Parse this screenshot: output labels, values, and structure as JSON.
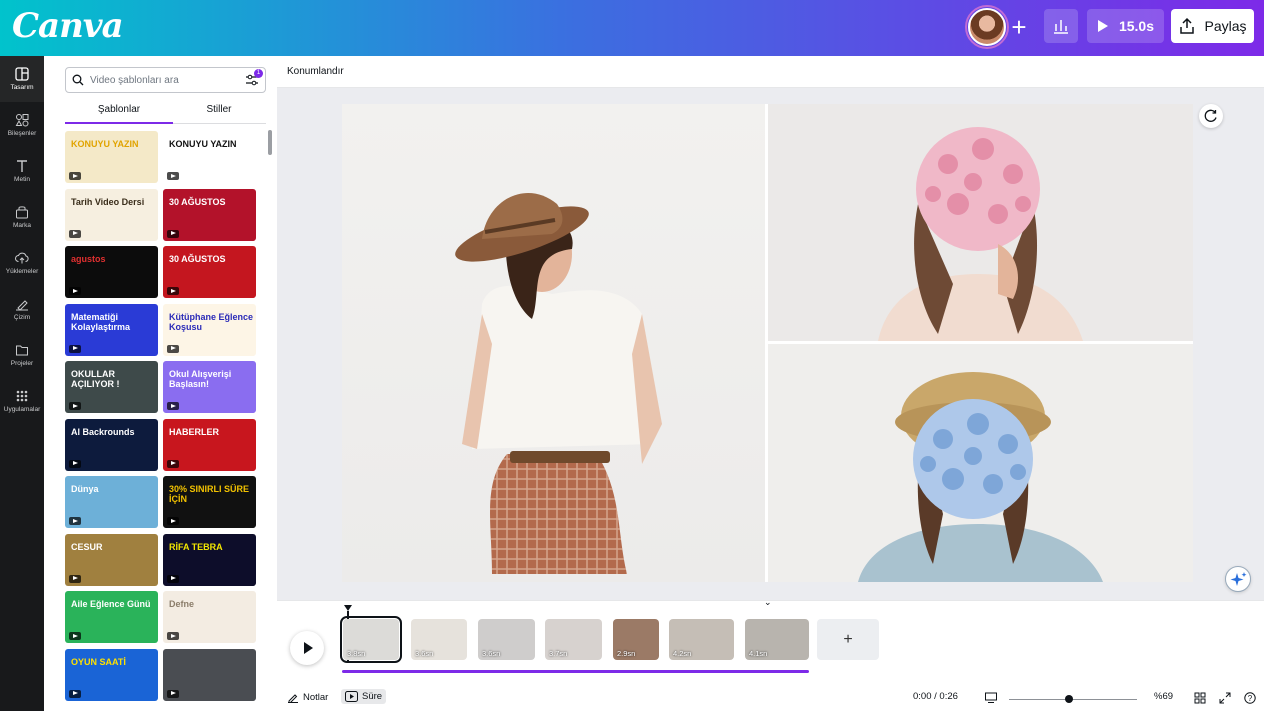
{
  "header": {
    "logo": "Canva",
    "present_label": "15.0s",
    "share_label": "Paylaş"
  },
  "rail": {
    "items": [
      {
        "label": "Tasarım",
        "icon": "layout-icon",
        "active": true
      },
      {
        "label": "Bileşenler",
        "icon": "shapes-icon"
      },
      {
        "label": "Metin",
        "icon": "text-icon"
      },
      {
        "label": "Marka",
        "icon": "brand-icon"
      },
      {
        "label": "Yüklemeler",
        "icon": "upload-icon"
      },
      {
        "label": "Çizim",
        "icon": "draw-icon"
      },
      {
        "label": "Projeler",
        "icon": "folder-icon"
      },
      {
        "label": "Uygulamalar",
        "icon": "apps-icon"
      }
    ]
  },
  "panel": {
    "search_placeholder": "Video şablonları ara",
    "filter_badge": "1",
    "tabs": [
      "Şablonlar",
      "Stiller"
    ],
    "templates": [
      {
        "text": "KONUYU YAZIN",
        "bg": "#f4e9c8",
        "fg": "#e1a400"
      },
      {
        "text": "KONUYU YAZIN",
        "bg": "#ffffff",
        "fg": "#111111"
      },
      {
        "text": "Tarih Video Dersi",
        "bg": "#f6efe0",
        "fg": "#3a2d1a"
      },
      {
        "text": "30 AĞUSTOS",
        "bg": "#b3122a",
        "fg": "#ffffff"
      },
      {
        "text": "agustos",
        "bg": "#0c0c0c",
        "fg": "#e03030"
      },
      {
        "text": "30 AĞUSTOS",
        "bg": "#c4161f",
        "fg": "#ffffff"
      },
      {
        "text": "Matematiği Kolaylaştırma",
        "bg": "#2a3bd6",
        "fg": "#ffffff"
      },
      {
        "text": "Kütüphane Eğlence Koşusu",
        "bg": "#fdf5e6",
        "fg": "#2b2bb8"
      },
      {
        "text": "OKULLAR AÇILIYOR !",
        "bg": "#3e4a4a",
        "fg": "#ffffff"
      },
      {
        "text": "Okul Alışverişi Başlasın!",
        "bg": "#8a6df0",
        "fg": "#ffffff"
      },
      {
        "text": "Al Backrounds",
        "bg": "#0d1b3d",
        "fg": "#ffffff"
      },
      {
        "text": "HABERLER",
        "bg": "#c8161e",
        "fg": "#ffffff"
      },
      {
        "text": "Dünya",
        "bg": "#6db0d8",
        "fg": "#ffffff"
      },
      {
        "text": "30% SINIRLI SÜRE İÇİN",
        "bg": "#111111",
        "fg": "#f2c200"
      },
      {
        "text": "CESUR",
        "bg": "#a0803f",
        "fg": "#ffffff"
      },
      {
        "text": "RİFA TEBRA",
        "bg": "#0d0d2a",
        "fg": "#f2e600"
      },
      {
        "text": "Aile Eğlence Günü",
        "bg": "#2ab35a",
        "fg": "#ffffff"
      },
      {
        "text": "Defne",
        "bg": "#f3ece2",
        "fg": "#8b7d6a"
      },
      {
        "text": "OYUN SAATİ",
        "bg": "#1a64d6",
        "fg": "#ffe100"
      },
      {
        "text": "",
        "bg": "#4a4d52",
        "fg": "#ffffff"
      }
    ]
  },
  "canvas": {
    "position_label": "Konumlandır"
  },
  "timeline": {
    "clips": [
      {
        "duration": "3.8sn",
        "bg": "#dcdbd8"
      },
      {
        "duration": "3.6sn",
        "bg": "#e6e2dc"
      },
      {
        "duration": "3.6sn",
        "bg": "#cfcdcc"
      },
      {
        "duration": "3.7sn",
        "bg": "#d7d2cf"
      },
      {
        "duration": "2.9sn",
        "bg": "#9b7a66"
      },
      {
        "duration": "4.2sn",
        "bg": "#c5beb6"
      },
      {
        "duration": "4.1sn",
        "bg": "#b8b4ae"
      }
    ]
  },
  "bottombar": {
    "notes_label": "Notlar",
    "duration_label": "Süre",
    "time": "0:00 / 0:26",
    "zoom": "%69",
    "zoom_level_percent": 69
  },
  "colors": {
    "accent": "#7d2ae8",
    "rail_bg": "#18191b"
  }
}
